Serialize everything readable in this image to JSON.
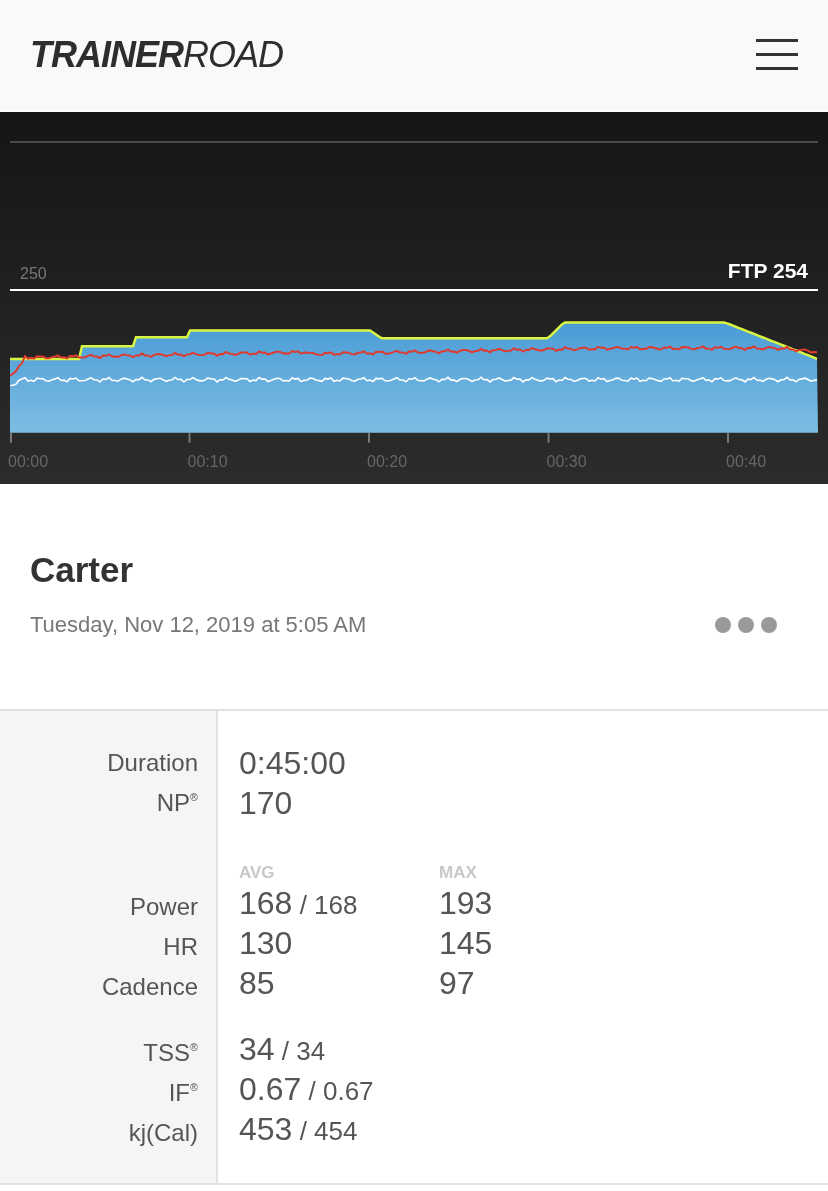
{
  "header": {
    "logo": "**TRAINER**ROAD"
  },
  "chart": {
    "y_label": "250",
    "ftp_label": "FTP 254",
    "time_labels": [
      "00:00",
      "00:10",
      "00:20",
      "00:30",
      "00:40"
    ]
  },
  "workout": {
    "title": "Carter",
    "date": "Tuesday, Nov 12, 2019 at 5:05 AM"
  },
  "stats": {
    "groups": [
      {
        "rows": [
          {
            "label": "Duration",
            "value": "0:45:00"
          },
          {
            "label": "NP$^{®}$",
            "value": "170"
          }
        ]
      },
      {
        "columns": [
          "AVG",
          "MAX"
        ],
        "rows": [
          {
            "label": "Power",
            "value": "168",
            "extra": "/ 168",
            "max": "193"
          },
          {
            "label": "HR",
            "value": "130",
            "max": "145"
          },
          {
            "label": "Cadence",
            "value": "85",
            "max": "97"
          }
        ]
      },
      {
        "rows": [
          {
            "label": "TSS$^{®}$",
            "value": "34",
            "extra": "/ 34"
          },
          {
            "label": "IF$^{®}$",
            "value": "0.67",
            "extra": "/ 0.67"
          },
          {
            "label": "kj(Cal)",
            "value": "453",
            "extra": "/ 454"
          }
        ]
      }
    ]
  }
}
